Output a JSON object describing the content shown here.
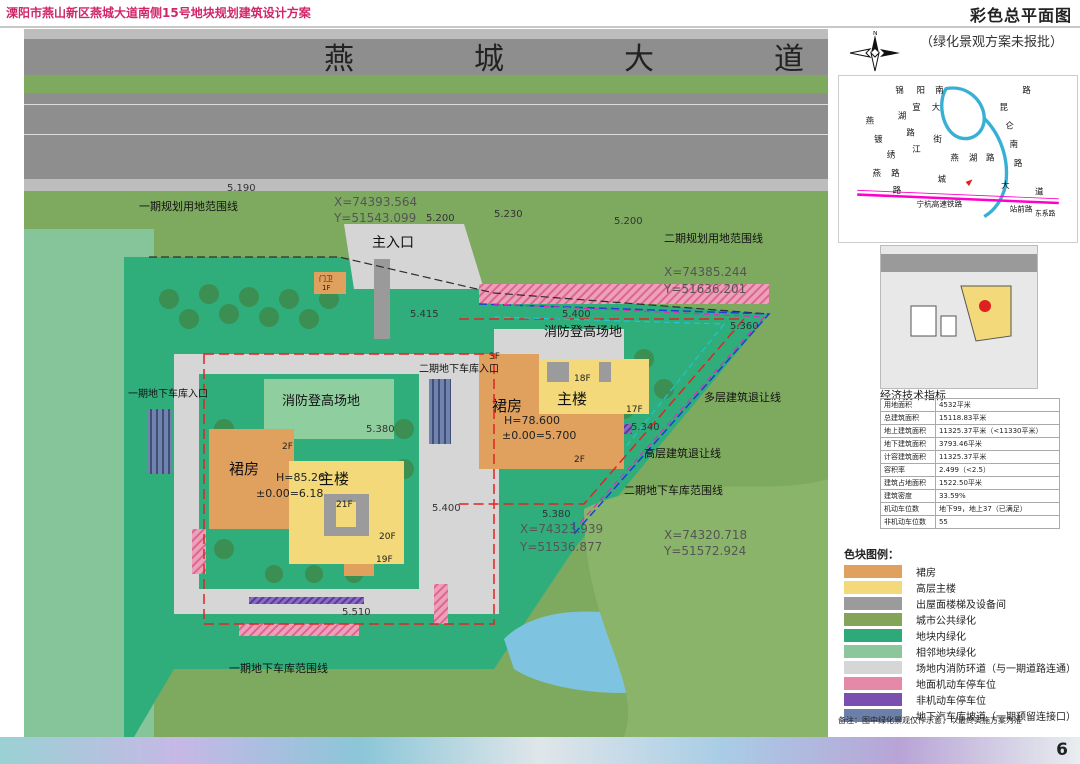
{
  "header": {
    "project_title": "溧阳市燕山新区燕城大道南侧15号地块规划建筑设计方案",
    "panel_title": "彩色总平面图",
    "subtitle": "（绿化景观方案未报批）"
  },
  "site": {
    "road_name": "燕城大道",
    "main_entrance": "主入口",
    "gate": "门卫",
    "gate_floor": "1F",
    "labels": {
      "phase1_boundary": "一期规划用地范围线",
      "phase2_boundary": "二期规划用地范围线",
      "fire_area_1": "消防登高场地",
      "fire_area_2": "消防登高场地",
      "garage_entry_1": "一期地下车库入口",
      "garage_entry_2": "二期地下车库入口",
      "setback_multi": "多层建筑退让线",
      "setback_high": "高层建筑退让线",
      "garage_boundary_2": "二期地下车库范围线",
      "garage_boundary_1": "一期地下车库范围线"
    },
    "coords": {
      "c1x": "X=74393.564",
      "c1y": "Y=51543.099",
      "c2x": "X=74385.244",
      "c2y": "Y=51636.201",
      "c3x": "X=74323.939",
      "c3y": "Y=51536.877",
      "c4x": "X=74320.718",
      "c4y": "Y=51572.924"
    },
    "elevations": {
      "e1": "5.190",
      "e2": "5.200",
      "e3": "5.230",
      "e4": "5.200",
      "e5": "5.415",
      "e6": "5.400",
      "e7": "5.360",
      "e8": "5.380",
      "e9": "5.340",
      "e10": "5.400",
      "e11": "5.380",
      "e12": "5.510"
    },
    "building1": {
      "podium": "裙房",
      "tower": "主楼",
      "height": "H=85.26",
      "level": "±0.00=6.18",
      "f_top": "21F",
      "f_a": "2F",
      "f_b": "20F",
      "f_c": "19F"
    },
    "building2": {
      "podium": "裙房",
      "tower": "主楼",
      "height": "H=78.600",
      "level": "±0.00=5.700",
      "f_a": "3F",
      "f_b": "18F",
      "f_c": "17F",
      "f_d": "2F"
    }
  },
  "location_map": {
    "road1": "锦",
    "road2": "阳",
    "road3": "南",
    "road4": "路",
    "road5": "昆",
    "road6": "仑",
    "road7": "南",
    "road8": "路",
    "road9": "燕",
    "road10": "湖",
    "road11": "路",
    "road12": "镀",
    "road13": "绣",
    "road14": "路",
    "road15": "宣",
    "road16": "大",
    "road17": "江",
    "road18": "街",
    "road19": "燕",
    "road20": "湖",
    "road21": "路",
    "road22": "燕",
    "road23": "城",
    "road24": "大",
    "road25": "道",
    "road26": "路",
    "rail": "宁杭高速铁路",
    "station": "站前路",
    "east": "东系路"
  },
  "eco": {
    "title": "经济技术指标",
    "rows": [
      [
        "用地面积",
        "4532平米"
      ],
      [
        "总建筑面积",
        "15118.83平米"
      ],
      [
        "地上建筑面积",
        "11325.37平米（<11330平米）"
      ],
      [
        "地下建筑面积",
        "3793.46平米"
      ],
      [
        "计容建筑面积",
        "11325.37平米"
      ],
      [
        "容积率",
        "2.499（<2.5）"
      ],
      [
        "建筑占地面积",
        "1522.50平米"
      ],
      [
        "建筑密度",
        "33.59%"
      ],
      [
        "机动车位数",
        "地下99，地上37（已满足）"
      ],
      [
        "非机动车位数",
        "55"
      ]
    ]
  },
  "legend": {
    "title": "色块图例：",
    "items": [
      {
        "label": "裙房",
        "color": "#e0a15e"
      },
      {
        "label": "高层主楼",
        "color": "#f3d97a"
      },
      {
        "label": "出屋面楼梯及设备间",
        "color": "#9b9b9b"
      },
      {
        "label": "城市公共绿化",
        "color": "#84a45a"
      },
      {
        "label": "地块内绿化",
        "color": "#2eaa7a"
      },
      {
        "label": "相邻地块绿化",
        "color": "#8cc79b"
      },
      {
        "label": "场地内消防环道（与一期道路连通）",
        "color": "#d6d6d6"
      },
      {
        "label": "地面机动车停车位",
        "color": "#e48aa8"
      },
      {
        "label": "非机动车停车位",
        "color": "#7b4fb0"
      },
      {
        "label": "地下汽车库坡道（一期预留连接口）",
        "color": "#6b7fa8"
      }
    ]
  },
  "note": "备注：图中绿化景观仅作示意，以最终实施方案为准",
  "page_number": "6"
}
